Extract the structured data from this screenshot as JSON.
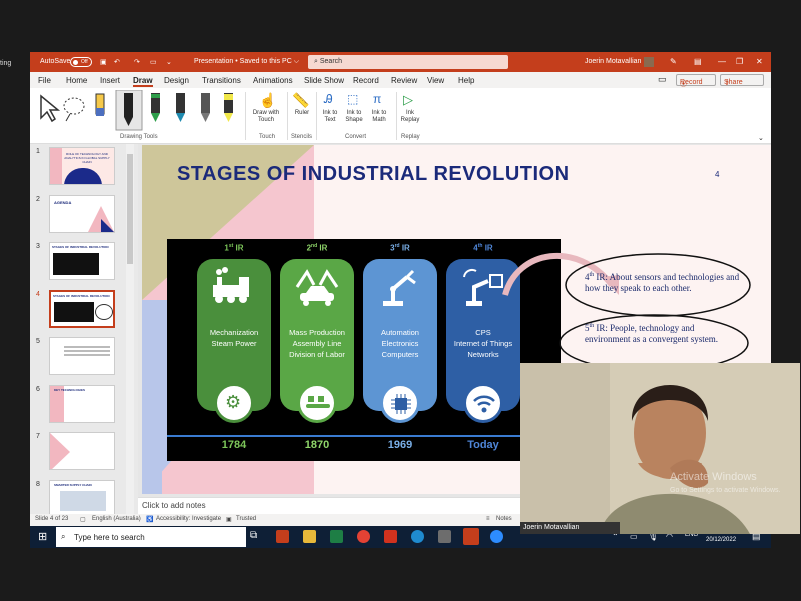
{
  "desktop": {
    "side_label": "ting"
  },
  "titlebar": {
    "autosave": "AutoSave",
    "autosave_state": "Off",
    "doc_title": "Presentation • Saved to this PC ⌵",
    "search": "Search",
    "user": "Joerin Motavallian"
  },
  "tabs": [
    "File",
    "Home",
    "Insert",
    "Draw",
    "Design",
    "Transitions",
    "Animations",
    "Slide Show",
    "Record",
    "Review",
    "View",
    "Help"
  ],
  "ribbon": {
    "record": "Record",
    "share": "Share",
    "groups": {
      "drawing_tools": "Drawing Tools",
      "touch": "Touch",
      "stencils": "Stencils",
      "convert": "Convert",
      "replay": "Replay"
    },
    "draw_with_touch": "Draw with Touch",
    "ruler": "Ruler",
    "ink_to_text": "Ink to Text",
    "ink_to_shape": "Ink to Shape",
    "ink_to_math": "Ink to Math",
    "ink_replay": "Ink Replay"
  },
  "thumbnails": [
    {
      "num": "1",
      "title": "ROLE OF TECHNOLOGY AND ANALYTICS IN GLOBAL SUPPLY CHAIN"
    },
    {
      "num": "2",
      "title": "AGENDA"
    },
    {
      "num": "3",
      "title": "STAGES OF INDUSTRIAL REVOLUTION"
    },
    {
      "num": "4",
      "title": "STAGES OF INDUSTRIAL REVOLUTION"
    },
    {
      "num": "5",
      "title": ""
    },
    {
      "num": "6",
      "title": "KEY TECHNOLOGIES"
    },
    {
      "num": "7",
      "title": ""
    },
    {
      "num": "8",
      "title": "SMARTER SUPPLY CHAIN"
    }
  ],
  "slide": {
    "title": "STAGES OF INDUSTRIAL REVOLUTION",
    "page_number": "4",
    "stages": [
      {
        "sup_num": "1",
        "sup": "st",
        "label": " IR",
        "lines": [
          "Mechanization",
          "Steam Power"
        ],
        "year": "1784",
        "color": "#4a8f3c"
      },
      {
        "sup_num": "2",
        "sup": "nd",
        "label": " IR",
        "lines": [
          "Mass Production",
          "Assembly Line",
          "Division of Labor"
        ],
        "year": "1870",
        "color": "#5aa746"
      },
      {
        "sup_num": "3",
        "sup": "rd",
        "label": " IR",
        "lines": [
          "Automation",
          "Electronics",
          "Computers"
        ],
        "year": "1969",
        "color": "#4b89c8"
      },
      {
        "sup_num": "4",
        "sup": "th",
        "label": " IR",
        "lines": [
          "CPS",
          "Internet of Things",
          "Networks"
        ],
        "year": "Today",
        "color": "#2e5fa5"
      }
    ],
    "note4_num": "4",
    "note4_sup": "th",
    "note4": " IR: About sensors and technologies and how they speak to each other.",
    "note5_num": "5",
    "note5_sup": "th",
    "note5": " IR: People, technology and environment as a convergent system."
  },
  "notes_placeholder": "Click to add notes",
  "status": {
    "slide": "Slide 4 of 23",
    "language": "English (Australia)",
    "accessibility": "Accessibility: Investigate",
    "trusted": "Trusted",
    "notes": "Notes"
  },
  "taskbar": {
    "search": "Type here to search",
    "lang": "ENG",
    "date": "20/12/2022"
  },
  "webcam": {
    "name": "Joerin Motavallian",
    "watermark1": "Activate Windows",
    "watermark2": "Go to Settings to activate Windows."
  },
  "colors": {
    "accent": "#c43e1c",
    "slide_title": "#1b2a7a",
    "taskbar": "#0e1f36"
  }
}
